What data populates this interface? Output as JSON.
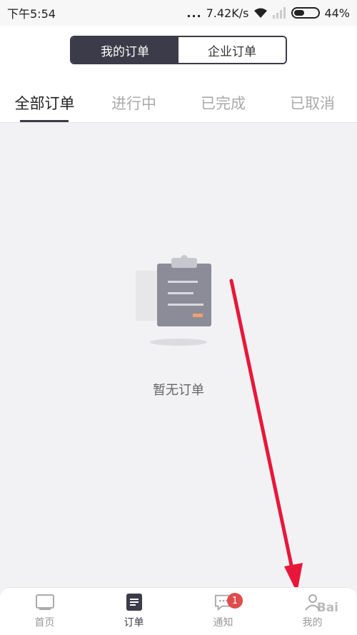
{
  "status_bar": {
    "time": "下午5:54",
    "dots": "...",
    "speed": "7.42K/s",
    "battery": "44%"
  },
  "segment": {
    "mine": "我的订单",
    "company": "企业订单"
  },
  "tabs": [
    {
      "label": "全部订单"
    },
    {
      "label": "进行中"
    },
    {
      "label": "已完成"
    },
    {
      "label": "已取消"
    }
  ],
  "empty": {
    "text": "暂无订单"
  },
  "bottom_nav": [
    {
      "label": "首页"
    },
    {
      "label": "订单"
    },
    {
      "label": "通知",
      "badge": "1"
    },
    {
      "label": "我的"
    }
  ],
  "watermark": "Bai"
}
